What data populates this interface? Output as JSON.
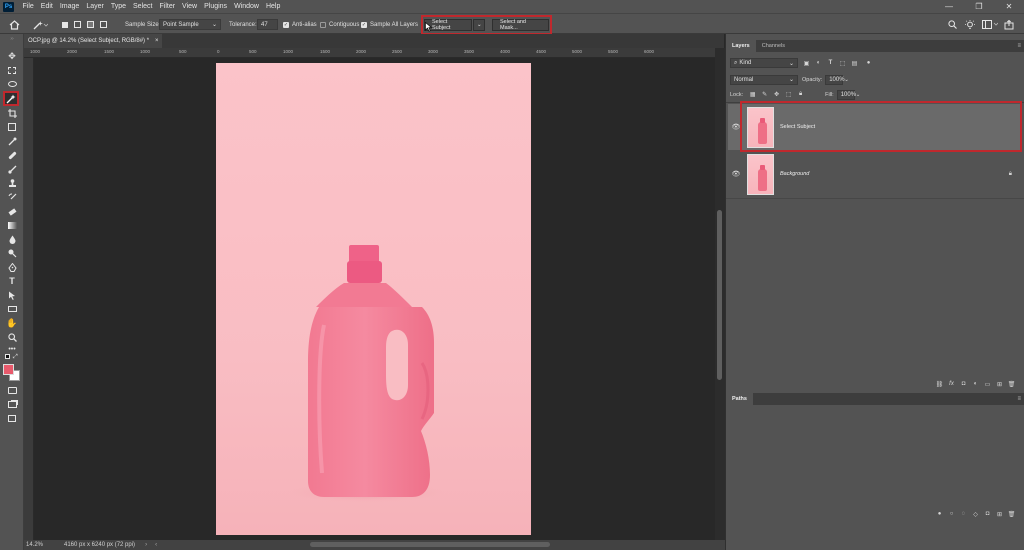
{
  "app": {
    "logo": "Ps"
  },
  "menu": [
    "File",
    "Edit",
    "Image",
    "Layer",
    "Type",
    "Select",
    "Filter",
    "View",
    "Plugins",
    "Window",
    "Help"
  ],
  "window_controls": {
    "minimize": "—",
    "maximize": "❐",
    "close": "✕"
  },
  "options_bar": {
    "sample_size_label": "Sample Size:",
    "sample_size_value": "Point Sample",
    "tolerance_label": "Tolerance:",
    "tolerance_value": "47",
    "anti_alias_label": "Anti-alias",
    "contiguous_label": "Contiguous",
    "sample_all_layers_label": "Sample All Layers",
    "select_subject_label": "Select Subject",
    "select_and_mask_label": "Select and Mask..."
  },
  "document_tab": {
    "title": "OCP.jpg @ 14.2% (Select Subject, RGB/8#) *",
    "close": "×"
  },
  "rulers": {
    "top": [
      "1000",
      "2000",
      "1500",
      "1000",
      "500",
      "0",
      "500",
      "1000",
      "1500",
      "2000",
      "2500",
      "3000",
      "3500",
      "4000",
      "4500",
      "5000",
      "5500",
      "6000"
    ]
  },
  "status_bar": {
    "zoom": "14.2%",
    "doc_info": "4160 px x 6240 px (72 ppi)"
  },
  "panels": {
    "layers_tab": "Layers",
    "channels_tab": "Channels",
    "kind_label": "Kind",
    "blend_mode": "Normal",
    "opacity_label": "Opacity:",
    "opacity_value": "100%",
    "lock_label": "Lock:",
    "fill_label": "Fill:",
    "fill_value": "100%",
    "layers": [
      {
        "name": "Select Subject",
        "visible": true,
        "selected": true
      },
      {
        "name": "Background",
        "visible": true,
        "locked": true
      }
    ],
    "paths_tab": "Paths"
  },
  "colors": {
    "accent_highlight": "#c0282d",
    "foreground_swatch": "#e85a6c",
    "background_swatch": "#ffffff"
  }
}
